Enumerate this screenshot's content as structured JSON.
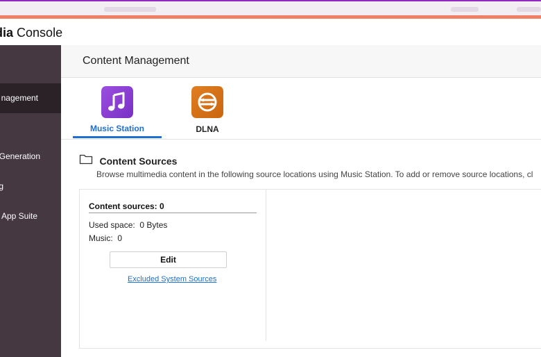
{
  "app": {
    "title_bold": "edia",
    "title_rest": " Console"
  },
  "colors": {
    "accent": "#ef7f65",
    "sidebar": "#453840",
    "sidebar_active": "#2b2227",
    "link": "#1e6fcf",
    "music_icon": "#8a3fd1",
    "dlna_icon": "#d9731a"
  },
  "sidebar": {
    "items": [
      {
        "label": "nagement",
        "active": true
      },
      {
        "label": "Generation",
        "active": false
      },
      {
        "label": "g",
        "active": false
      },
      {
        "label": "App Suite",
        "active": false
      }
    ]
  },
  "page": {
    "title": "Content Management"
  },
  "tabs": [
    {
      "label": "Music Station",
      "icon": "music-note-icon",
      "active": true
    },
    {
      "label": "DLNA",
      "icon": "dlna-icon",
      "active": false
    }
  ],
  "content_sources": {
    "title": "Content Sources",
    "description": "Browse multimedia content in the following source locations using Music Station. To add or remove source locations, cl",
    "card": {
      "title": "Content sources: 0",
      "used_space_label": "Used space:",
      "used_space_value": "0 Bytes",
      "music_label": "Music:",
      "music_value": "0",
      "edit_label": "Edit",
      "excluded_link": "Excluded System Sources"
    }
  }
}
